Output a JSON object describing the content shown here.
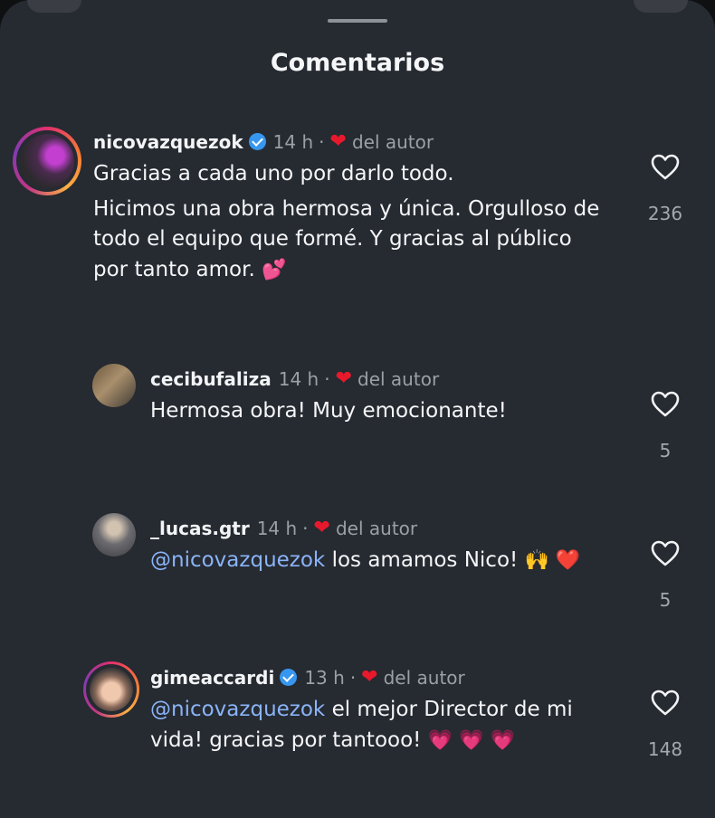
{
  "title": "Comentarios",
  "mini_heart": "❤",
  "comments": [
    {
      "user": "nicovazquezok",
      "time": "14 h",
      "author_label": "del autor",
      "lines": [
        "Gracias a cada uno por darlo todo.",
        "Hicimos una obra hermosa y única. Orgulloso de",
        "todo el equipo que formé. Y gracias al público",
        "por tanto amor."
      ],
      "emoji": "💕",
      "likes": "236"
    },
    {
      "user": "cecibufaliza",
      "time": "14 h",
      "author_label": "del autor",
      "text": "Hermosa obra! Muy emocionante!",
      "likes": "5"
    },
    {
      "user": "_lucas.gtr",
      "time": "14 h",
      "author_label": "del autor",
      "mention": "@nicovazquezok",
      "text": "los amamos Nico!",
      "emoji": "🙌 ❤️",
      "likes": "5"
    },
    {
      "user": "gimeaccardi",
      "time": "13 h",
      "author_label": "del autor",
      "mention": "@nicovazquezok",
      "text1": "el mejor Director de mi",
      "text2": "vida! gracias por tantooo!",
      "emoji": "💗 💗 💗",
      "likes": "148"
    }
  ]
}
